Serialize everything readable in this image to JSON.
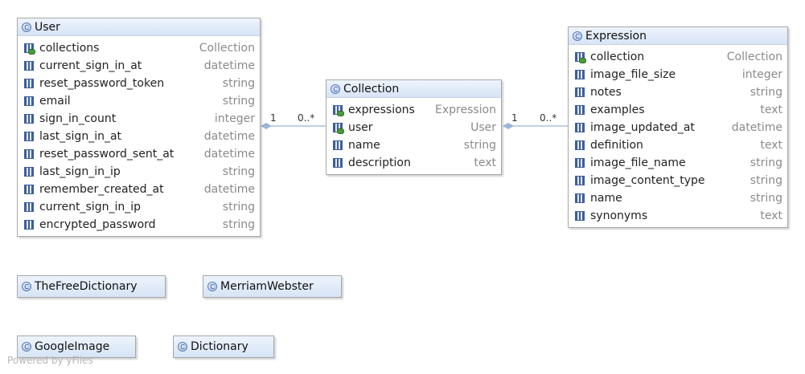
{
  "classes": {
    "user": {
      "name": "User",
      "attributes": [
        {
          "name": "collections",
          "type": "Collection",
          "assoc": true
        },
        {
          "name": "current_sign_in_at",
          "type": "datetime"
        },
        {
          "name": "reset_password_token",
          "type": "string"
        },
        {
          "name": "email",
          "type": "string"
        },
        {
          "name": "sign_in_count",
          "type": "integer"
        },
        {
          "name": "last_sign_in_at",
          "type": "datetime"
        },
        {
          "name": "reset_password_sent_at",
          "type": "datetime"
        },
        {
          "name": "last_sign_in_ip",
          "type": "string"
        },
        {
          "name": "remember_created_at",
          "type": "datetime"
        },
        {
          "name": "current_sign_in_ip",
          "type": "string"
        },
        {
          "name": "encrypted_password",
          "type": "string"
        }
      ]
    },
    "collection": {
      "name": "Collection",
      "attributes": [
        {
          "name": "expressions",
          "type": "Expression",
          "assoc": true
        },
        {
          "name": "user",
          "type": "User",
          "assoc": true
        },
        {
          "name": "name",
          "type": "string"
        },
        {
          "name": "description",
          "type": "text"
        }
      ]
    },
    "expression": {
      "name": "Expression",
      "attributes": [
        {
          "name": "collection",
          "type": "Collection",
          "assoc": true
        },
        {
          "name": "image_file_size",
          "type": "integer"
        },
        {
          "name": "notes",
          "type": "string"
        },
        {
          "name": "examples",
          "type": "text"
        },
        {
          "name": "image_updated_at",
          "type": "datetime"
        },
        {
          "name": "definition",
          "type": "text"
        },
        {
          "name": "image_file_name",
          "type": "string"
        },
        {
          "name": "image_content_type",
          "type": "string"
        },
        {
          "name": "name",
          "type": "string"
        },
        {
          "name": "synonyms",
          "type": "text"
        }
      ]
    },
    "thefreedictionary": {
      "name": "TheFreeDictionary"
    },
    "merriamwebster": {
      "name": "MerriamWebster"
    },
    "googleimage": {
      "name": "GoogleImage"
    },
    "dictionary": {
      "name": "Dictionary"
    }
  },
  "edges": {
    "user_collection": {
      "source_mult": "1",
      "target_mult": "0..*"
    },
    "collection_expression": {
      "source_mult": "1",
      "target_mult": "0..*"
    }
  },
  "icons": {
    "class": "class-icon",
    "attribute": "attribute-icon",
    "association": "association-attribute-icon"
  },
  "watermark": "Powered by yFiles"
}
